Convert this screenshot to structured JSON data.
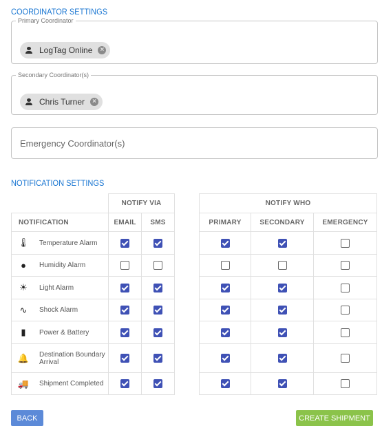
{
  "coordinator": {
    "title": "COORDINATOR SETTINGS",
    "primary_legend": "Primary Coordinator",
    "primary_chip": "LogTag Online",
    "secondary_legend": "Secondary Coordinator(s)",
    "secondary_chip": "Chris Turner",
    "emergency_placeholder": "Emergency Coordinator(s)"
  },
  "notification": {
    "title": "NOTIFICATION SETTINGS",
    "group_via": "NOTIFY VIA",
    "group_who": "NOTIFY WHO",
    "columns": [
      "NOTIFICATION",
      "EMAIL",
      "SMS",
      "PRIMARY",
      "SECONDARY",
      "EMERGENCY"
    ],
    "rows": [
      {
        "icon": "thermometer-icon",
        "label": "Temperature Alarm",
        "checks": [
          true,
          true,
          true,
          true,
          false
        ]
      },
      {
        "icon": "water-drop-icon",
        "label": "Humidity Alarm",
        "checks": [
          false,
          false,
          false,
          false,
          false
        ]
      },
      {
        "icon": "sun-icon",
        "label": "Light Alarm",
        "checks": [
          true,
          true,
          true,
          true,
          false
        ]
      },
      {
        "icon": "pulse-icon",
        "label": "Shock Alarm",
        "checks": [
          true,
          true,
          true,
          true,
          false
        ]
      },
      {
        "icon": "battery-icon",
        "label": "Power & Battery",
        "checks": [
          true,
          true,
          true,
          true,
          false
        ]
      },
      {
        "icon": "bell-icon",
        "label": "Destination Boundary Arrival",
        "checks": [
          true,
          true,
          true,
          true,
          false
        ]
      },
      {
        "icon": "truck-icon",
        "label": "Shipment Completed",
        "checks": [
          true,
          true,
          true,
          true,
          false
        ]
      }
    ]
  },
  "buttons": {
    "back": "BACK",
    "create": "CREATE SHIPMENT"
  },
  "colors": {
    "accent": "#1976d2",
    "checkbox": "#3f51b5",
    "back_button": "#5c8ad8",
    "create_button": "#8bc34a"
  }
}
